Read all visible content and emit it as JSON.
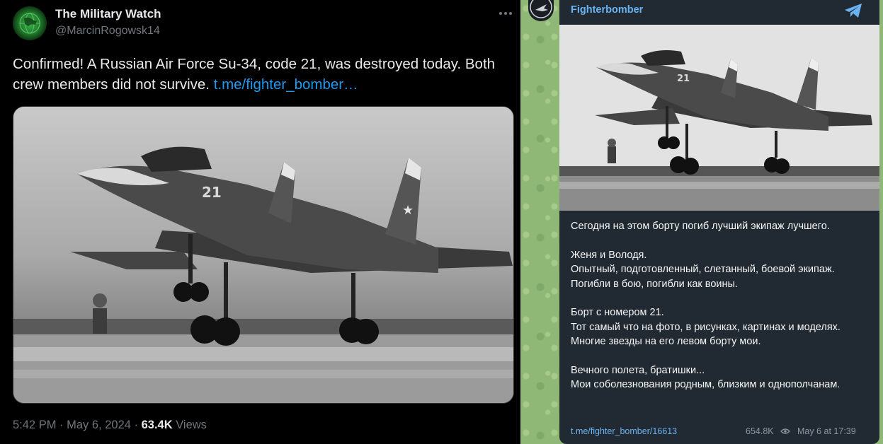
{
  "tweet": {
    "author_name": "The Military Watch",
    "author_handle": "@MarcinRogowsk14",
    "more_icon": "more-horizontal-icon",
    "text": "Confirmed! A Russian Air Force Su-34, code 21, was destroyed today. Both crew members did not survive.",
    "link_text": "t.me/fighter_bomber…",
    "time": "5:42 PM · May 6, 2024 · ",
    "views_count": "63.4K",
    "views_label": " Views",
    "aircraft_code": "21"
  },
  "telegram": {
    "channel_name": "Fighterbomber",
    "app_icon": "telegram-icon",
    "aircraft_code": "21",
    "paragraphs": [
      "Сегодня на этом борту погиб лучший экипаж лучшего.",
      "Женя и Володя.\nОпытный, подготовленный, слетанный, боевой экипаж.\nПогибли в бою, погибли как воины.",
      "Борт с номером 21.\nТот самый что на фото, в рисунках, картинах и моделях.\nМногие звезды на его левом борту мои.",
      "Вечного полета, братишки...\nМои соболезнования родным, близким и однополчанам."
    ],
    "post_link": "t.me/fighter_bomber/16613",
    "views": "654.8K",
    "date": "May 6 at 17:39"
  },
  "colors": {
    "twitter_bg": "#000000",
    "twitter_link": "#1d9bf0",
    "telegram_card": "#212a33",
    "telegram_link": "#6ab3f3",
    "telegram_wallpaper": "#8fb877"
  }
}
